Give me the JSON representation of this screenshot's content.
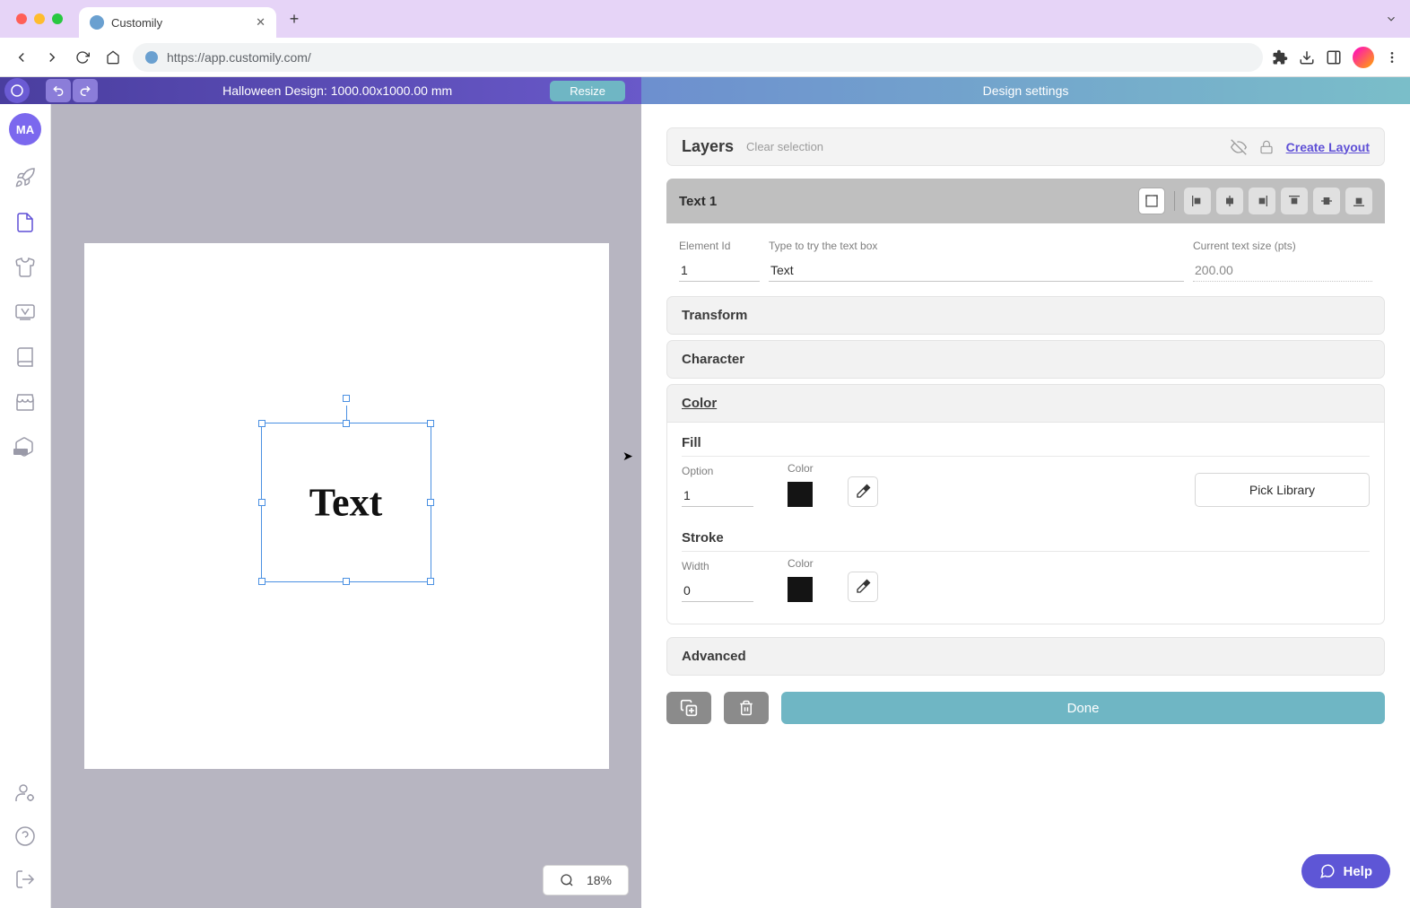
{
  "browser": {
    "tab_title": "Customily",
    "url": "https://app.customily.com/"
  },
  "header": {
    "design_name": "Halloween Design: 1000.00x1000.00 mm",
    "resize_label": "Resize",
    "panel_title": "Design settings"
  },
  "sidebar": {
    "avatar": "MA"
  },
  "canvas": {
    "text": "Text",
    "zoom": "18%"
  },
  "layers": {
    "title": "Layers",
    "clear": "Clear selection",
    "create_layout": "Create Layout",
    "selected": "Text 1"
  },
  "fields": {
    "element_id_label": "Element Id",
    "element_id": "1",
    "type_label": "Type to try the text box",
    "type_value": "Text",
    "size_label": "Current text size (pts)",
    "size_value": "200.00"
  },
  "sections": {
    "transform": "Transform",
    "character": "Character",
    "color": "Color",
    "advanced": "Advanced"
  },
  "color": {
    "fill_title": "Fill",
    "option_label": "Option",
    "option_value": "1",
    "color_label": "Color",
    "fill_color": "#141414",
    "pick_library": "Pick Library",
    "stroke_title": "Stroke",
    "width_label": "Width",
    "width_value": "0",
    "stroke_color": "#141414"
  },
  "actions": {
    "done": "Done"
  },
  "help": {
    "label": "Help"
  }
}
